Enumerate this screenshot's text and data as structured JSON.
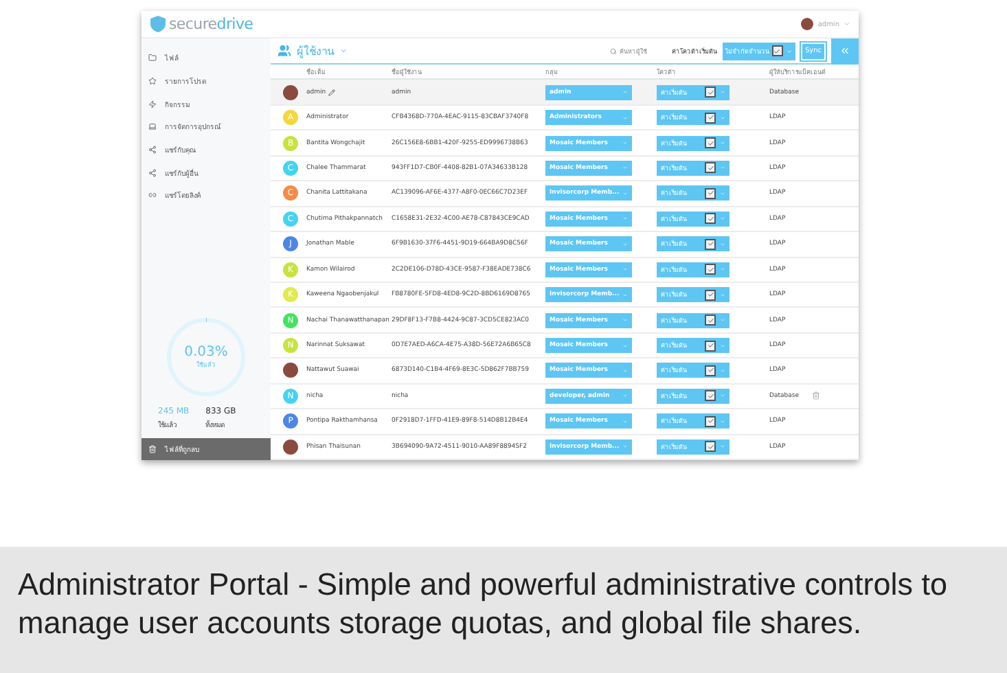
{
  "app": {
    "logo": {
      "part_1": "secure",
      "part_2": "drive"
    },
    "user_menu": "admin"
  },
  "sidebar": {
    "items": [
      {
        "label": "ไฟล์",
        "selected": false
      },
      {
        "label": "รายการโปรด",
        "selected": false
      },
      {
        "label": "กิจกรรม",
        "selected": false
      },
      {
        "label": "การจัดการอุปกรณ์",
        "selected": false
      },
      {
        "label": "แชร์กับคุณ",
        "selected": false
      },
      {
        "label": "แชร์กับผู้อื่น",
        "selected": false
      },
      {
        "label": "แชร์โดยลิงค์",
        "selected": false
      }
    ],
    "storage": {
      "percent": "0.03%",
      "percent_label": "ใช้แล้ว",
      "level": 0.0003,
      "used": "245 MB",
      "used_label": "ใช้แล้ว",
      "total": "833 GB",
      "total_label": "ทั้งหมด"
    },
    "trash": "ไฟล์ที่ถูกลบ"
  },
  "toolbar": {
    "title": "ผู้ใช้งาน",
    "search_placeholder": "ค้นหาผู้ใช้",
    "quota_label": "ค่าโควต้าเริ่มต้น",
    "quota_value": "ไม่จำกัดจำนวน",
    "sync": "Sync"
  },
  "table": {
    "columns": [
      "ชื่อเต็ม",
      "ชื่อผู้ใช้งาน",
      "กลุ่ม",
      "โควต้า",
      "ผู้ให้บริการแบ็คเอนด์"
    ],
    "rows": [
      {
        "avatar": {
          "kind": "photo"
        },
        "name": "admin",
        "editable": true,
        "username": "admin",
        "group": "admin",
        "quota": "ค่าเริ่มต้น",
        "backend": "Database",
        "deletable": false,
        "selected": true
      },
      {
        "avatar": {
          "kind": "letter",
          "letter": "A",
          "color": "#f5d63d"
        },
        "name": "Administrator",
        "editable": false,
        "username": "CFB4368D-770A-4EAC-9115-83CBAF3740F8",
        "group": "Administrators",
        "quota": "ค่าเริ่มต้น",
        "backend": "LDAP",
        "deletable": false,
        "selected": false
      },
      {
        "avatar": {
          "kind": "letter",
          "letter": "B",
          "color": "#c6e33f"
        },
        "name": "Bantita Wongchajit",
        "editable": false,
        "username": "26C156E8-6BB1-420F-9255-ED9996738B63",
        "group": "Mosaic Members",
        "quota": "ค่าเริ่มต้น",
        "backend": "LDAP",
        "deletable": false,
        "selected": false
      },
      {
        "avatar": {
          "kind": "letter",
          "letter": "C",
          "color": "#45d3f2"
        },
        "name": "Chalee Thammarat",
        "editable": false,
        "username": "943FF1D7-CB0F-4408-82B1-07A34633B128",
        "group": "Mosaic Members",
        "quota": "ค่าเริ่มต้น",
        "backend": "LDAP",
        "deletable": false,
        "selected": false
      },
      {
        "avatar": {
          "kind": "letter",
          "letter": "C",
          "color": "#f68b47"
        },
        "name": "Chanita Lattitakana",
        "editable": false,
        "username": "AC139096-AF6E-4377-A8F0-0EC66C7D23EF",
        "group": "Invisorcorp Memb...",
        "quota": "ค่าเริ่มต้น",
        "backend": "LDAP",
        "deletable": false,
        "selected": false
      },
      {
        "avatar": {
          "kind": "letter",
          "letter": "C",
          "color": "#45d3f2"
        },
        "name": "Chutima Pithakpannatch",
        "editable": false,
        "username": "C1658E31-2E32-4C00-AE78-C87843CE9CAD",
        "group": "Mosaic Members",
        "quota": "ค่าเริ่มต้น",
        "backend": "LDAP",
        "deletable": false,
        "selected": false
      },
      {
        "avatar": {
          "kind": "letter",
          "letter": "J",
          "color": "#4d86e6"
        },
        "name": "Jonathan Mable",
        "editable": false,
        "username": "6F9B1630-37F6-4451-9D19-664BA9D8C56F",
        "group": "Mosaic Members",
        "quota": "ค่าเริ่มต้น",
        "backend": "LDAP",
        "deletable": false,
        "selected": false
      },
      {
        "avatar": {
          "kind": "letter",
          "letter": "K",
          "color": "#c6e33f"
        },
        "name": "Kamon Wilairod",
        "editable": false,
        "username": "2C2DE106-D78D-43CE-9587-F38EADE738C6",
        "group": "Mosaic Members",
        "quota": "ค่าเริ่มต้น",
        "backend": "LDAP",
        "deletable": false,
        "selected": false
      },
      {
        "avatar": {
          "kind": "letter",
          "letter": "K",
          "color": "#e2ea4c"
        },
        "name": "Kaweena Ngaobenjakul",
        "editable": false,
        "username": "FB8780FE-5FD8-4ED8-9C2D-8BD6169D8765",
        "group": "Invisorcorp Memb...",
        "quota": "ค่าเริ่มต้น",
        "backend": "LDAP",
        "deletable": false,
        "selected": false
      },
      {
        "avatar": {
          "kind": "letter",
          "letter": "N",
          "color": "#42e45c"
        },
        "name": "Nachai Thanawatthanapan",
        "editable": false,
        "username": "29DF8F13-F7B8-4424-9C87-3CD5CE823AC0",
        "group": "Mosaic Members",
        "quota": "ค่าเริ่มต้น",
        "backend": "LDAP",
        "deletable": false,
        "selected": false
      },
      {
        "avatar": {
          "kind": "letter",
          "letter": "N",
          "color": "#c6e33f"
        },
        "name": "Narinnat Suksawat",
        "editable": false,
        "username": "0D7E7AED-A6CA-4E75-A38D-56E72A6B65C8",
        "group": "Mosaic Members",
        "quota": "ค่าเริ่มต้น",
        "backend": "LDAP",
        "deletable": false,
        "selected": false
      },
      {
        "avatar": {
          "kind": "photo"
        },
        "name": "Nattawut Suawai",
        "editable": false,
        "username": "6873D140-C1B4-4F69-8E3C-5D862F7BB759",
        "group": "Mosaic Members",
        "quota": "ค่าเริ่มต้น",
        "backend": "LDAP",
        "deletable": false,
        "selected": false
      },
      {
        "avatar": {
          "kind": "letter",
          "letter": "N",
          "color": "#45d3f2"
        },
        "name": "nicha",
        "editable": false,
        "username": "nicha",
        "group": "developer, admin",
        "quota": "ค่าเริ่มต้น",
        "backend": "Database",
        "deletable": true,
        "selected": false
      },
      {
        "avatar": {
          "kind": "letter",
          "letter": "P",
          "color": "#4d86e6"
        },
        "name": "Pontipa Rakthamhansa",
        "editable": false,
        "username": "0F2918D7-1FFD-41E9-89F8-514D8B12B4E4",
        "group": "Mosaic Members",
        "quota": "ค่าเริ่มต้น",
        "backend": "LDAP",
        "deletable": false,
        "selected": false
      },
      {
        "avatar": {
          "kind": "photo"
        },
        "name": "Phisan Thaisunan",
        "editable": false,
        "username": "3B694090-9A72-4511-9010-AA89F8894SF2",
        "group": "Invisorcorp Memb...",
        "quota": "ค่าเริ่มต้น",
        "backend": "LDAP",
        "deletable": false,
        "selected": false
      }
    ]
  },
  "caption": "Administrator Portal - Simple and powerful administrative controls to manage user accounts storage quotas, and global file shares."
}
